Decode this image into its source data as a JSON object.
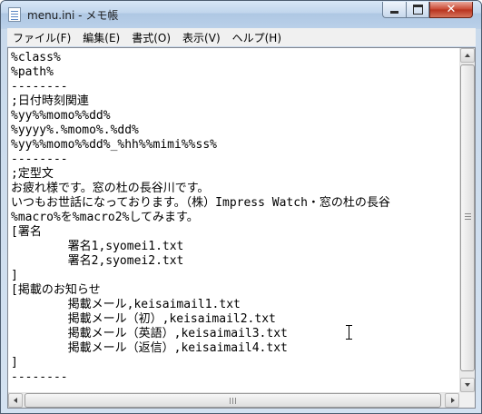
{
  "window": {
    "title": "menu.ini - メモ帳"
  },
  "menubar": [
    {
      "label": "ファイル(F)"
    },
    {
      "label": "編集(E)"
    },
    {
      "label": "書式(O)"
    },
    {
      "label": "表示(V)"
    },
    {
      "label": "ヘルプ(H)"
    }
  ],
  "editor": {
    "lines": [
      "%class%",
      "%path%",
      "--------",
      ";日付時刻関連",
      "%yy%%momo%%dd%",
      "%yyyy%.%momo%.%dd%",
      "%yy%%momo%%dd%_%hh%%mimi%%ss%",
      "--------",
      ";定型文",
      "お疲れ様です。窓の杜の長谷川です。",
      "いつもお世話になっております。（株）Impress Watch・窓の杜の長谷",
      "%macro%を%macro2%してみます。",
      "[署名",
      "\t署名1,syomei1.txt",
      "\t署名2,syomei2.txt",
      "]",
      "[掲載のお知らせ",
      "\t掲載メール,keisaimail1.txt",
      "\t掲載メール（初）,keisaimail2.txt",
      "\t掲載メール（英語）,keisaimail3.txt",
      "\t掲載メール（返信）,keisaimail4.txt",
      "]",
      "--------"
    ]
  },
  "icons": {
    "app": "notepad-icon",
    "minimize": "minimize-icon",
    "maximize": "maximize-icon",
    "close": "close-icon",
    "cursor": "text-cursor-icon"
  },
  "colors": {
    "close_button": "#c94530",
    "titlebar": "#bad0e9",
    "menubar": "#f0f0f0",
    "editor_background": "#ffffff"
  }
}
